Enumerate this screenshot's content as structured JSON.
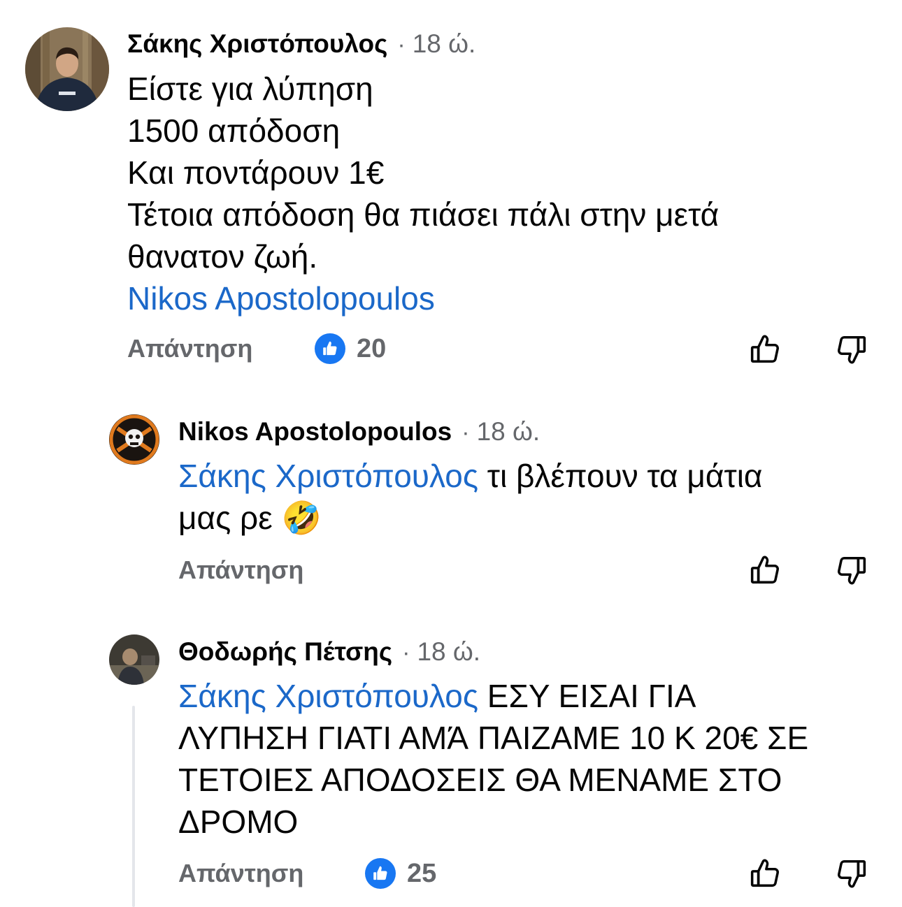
{
  "comments": [
    {
      "author": "Σάκης Χριστόπουλος",
      "time": "18 ώ.",
      "lines": [
        "Είστε για λύπηση",
        "1500 απόδοση",
        "Και ποντάρουν 1€",
        "Τέτοια απόδοση θα πιάσει πάλι στην μετά",
        "θανατον ζωή."
      ],
      "mention": "Nikos Apostolopoulos",
      "reply_label": "Απάντηση",
      "like_count": "20"
    },
    {
      "author": "Nikos Apostolopoulos",
      "time": "18 ώ.",
      "mention": "Σάκης Χριστόπουλος",
      "line1_text": " τι βλέπουν τα μάτια",
      "line2_text": "μας ρε ",
      "emoji": "🤣",
      "reply_label": "Απάντηση"
    },
    {
      "author": "Θοδωρής Πέτσης",
      "time": "18 ώ.",
      "mention": "Σάκης Χριστόπουλος",
      "line1_text": " ΕΣΥ ΕΙΣΑΙ ΓΙΑ",
      "lines": [
        "ΛΥΠΗΣΗ ΓΙΑΤΙ ΑΜΆ ΠΑΙΖΑΜΕ 10 Κ 20€ ΣΕ",
        "ΤΕΤΟΙΕΣ ΑΠΟΔΟΣΕΙΣ ΘΑ ΜΕΝΑΜΕ ΣΤΟ",
        "ΔΡΟΜΟ"
      ],
      "reply_label": "Απάντηση",
      "like_count": "25"
    }
  ],
  "separator": "·",
  "icons": {
    "like_reaction": "thumbs-up-reaction-icon",
    "like_button": "thumbs-up-outline-icon",
    "dislike_button": "thumbs-down-outline-icon"
  },
  "colors": {
    "mention": "#1b68c9",
    "meta": "#65676b",
    "like_blue": "#1877f2"
  }
}
